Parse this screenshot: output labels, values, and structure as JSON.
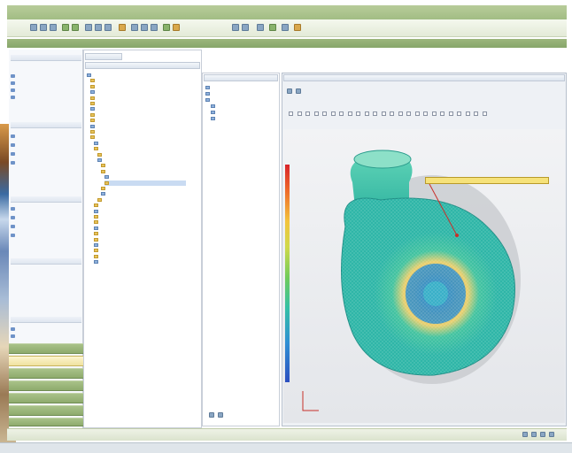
{
  "window": {
    "title": "",
    "menus": []
  },
  "toolbar": {
    "zoom_value": "",
    "view_value": ""
  },
  "navigator": {
    "sections": [],
    "buttons": []
  },
  "tree": {
    "tab_label": "",
    "rows": []
  },
  "properties": {
    "rows": []
  },
  "viewer": {
    "tab_label": "",
    "result_lines": [],
    "legend_values": [],
    "annotation": ""
  },
  "status": {
    "text": ""
  },
  "colors": {
    "chrome_green": "#9cb67d",
    "selection_yellow": "#efe2a0",
    "link_blue": "#2b5c9a",
    "legend_top": "#d8232a",
    "legend_bottom": "#2b4fbf",
    "impeller_teal": "#33c0a6"
  },
  "icons": [
    "save-icon",
    "open-icon",
    "print-icon",
    "zoom-icon",
    "rotate-icon",
    "pan-icon",
    "folder-icon",
    "close-icon"
  ]
}
